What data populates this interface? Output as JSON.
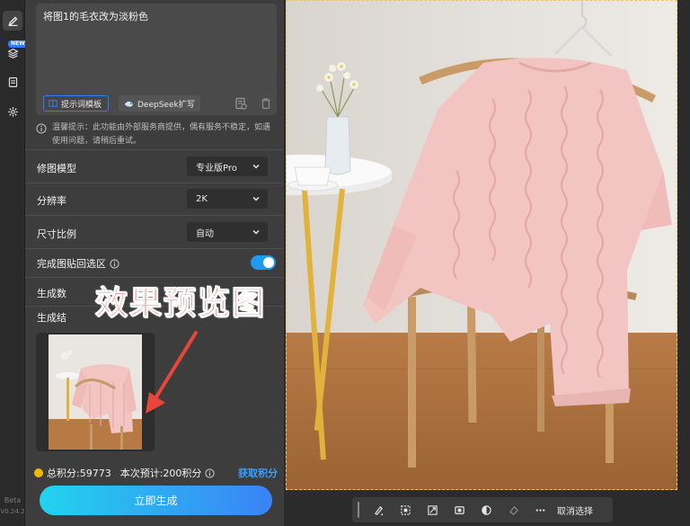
{
  "rail": {
    "badge": "NEW",
    "version_line1": "Beta",
    "version_line2": "V0.24.2",
    "icons": [
      "pen-icon",
      "layers-icon",
      "document-icon",
      "gear-icon"
    ]
  },
  "prompt": {
    "text": "将图1的毛衣改为淡粉色",
    "template_button": "提示词模板",
    "deepseek_button": "DeepSeek扩写",
    "tip": "温馨提示：此功能由外部服务商提供，偶有服务不稳定，如遇使用问题，请稍后重试。"
  },
  "settings": {
    "model_label": "修图模型",
    "model_value": "专业版Pro",
    "resolution_label": "分辨率",
    "resolution_value": "2K",
    "ratio_label": "尺寸比例",
    "ratio_value": "自动",
    "paste_label": "完成图贴回选区",
    "paste_enabled": true,
    "count_label": "生成数",
    "result_label": "生成结"
  },
  "overlay": {
    "caption": "效果预览图",
    "color": "#e8463a"
  },
  "footer": {
    "total_points": "总积分:59773",
    "estimate": "本次预计:200积分",
    "get_points": "获取积分",
    "generate_button": "立即生成"
  },
  "toolbar": {
    "cancel_selection": "取消选择",
    "icons": [
      "brush-icon",
      "select-rect-icon",
      "expand-icon",
      "mask-icon",
      "contrast-icon",
      "eraser-icon",
      "more-icon"
    ]
  },
  "colors": {
    "accent": "#2f7df6",
    "toggle": "#1e9bf0",
    "points_link": "#3aa0ff",
    "sweater": "#f2c5c3"
  }
}
